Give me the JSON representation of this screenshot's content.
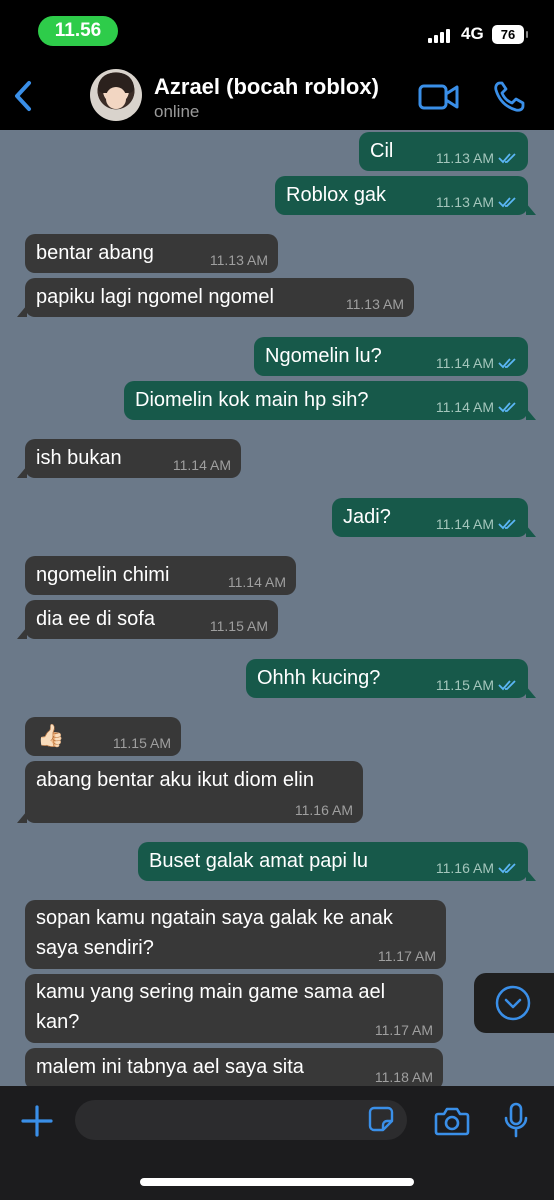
{
  "status_bar": {
    "time": "11.56",
    "network": "4G",
    "battery": "76"
  },
  "header": {
    "contact_name": "Azrael (bocah roblox)",
    "contact_status": "online"
  },
  "messages": [
    {
      "dir": "out",
      "text": "Cil",
      "time": "11.13 AM"
    },
    {
      "dir": "out",
      "text": "Roblox gak",
      "time": "11.13 AM"
    },
    {
      "dir": "in",
      "text": "bentar abang",
      "time": "11.13 AM"
    },
    {
      "dir": "in",
      "text": "papiku lagi ngomel ngomel",
      "time": "11.13 AM"
    },
    {
      "dir": "out",
      "text": "Ngomelin lu?",
      "time": "11.14 AM"
    },
    {
      "dir": "out",
      "text": "Diomelin kok main hp sih?",
      "time": "11.14 AM"
    },
    {
      "dir": "in",
      "text": "ish bukan",
      "time": "11.14 AM"
    },
    {
      "dir": "out",
      "text": "Jadi?",
      "time": "11.14 AM"
    },
    {
      "dir": "in",
      "text": "ngomelin chimi",
      "time": "11.14 AM"
    },
    {
      "dir": "in",
      "text": "dia ee di sofa",
      "time": "11.15 AM"
    },
    {
      "dir": "out",
      "text": "Ohhh kucing?",
      "time": "11.15 AM"
    },
    {
      "dir": "in",
      "text": "👍🏻",
      "time": "11.15 AM"
    },
    {
      "dir": "in",
      "text": "abang bentar aku ikut diom elin",
      "time": "11.16 AM"
    },
    {
      "dir": "out",
      "text": "Buset galak amat papi lu",
      "time": "11.16 AM"
    },
    {
      "dir": "in",
      "text": "sopan kamu ngatain saya galak ke anak saya sendiri?",
      "time": "11.17 AM"
    },
    {
      "dir": "in",
      "text": "kamu yang sering main game sama ael kan?",
      "time": "11.17 AM"
    },
    {
      "dir": "in",
      "text": "malem ini tabnya ael saya sita",
      "time": "11.18 AM"
    }
  ],
  "icons": {
    "back": "chevron-left-icon",
    "video": "video-camera-icon",
    "call": "phone-icon",
    "scroll_down": "chevron-down-circle-icon",
    "plus": "plus-icon",
    "sticker": "sticker-icon",
    "camera": "camera-icon",
    "mic": "microphone-icon"
  },
  "colors": {
    "accent": "#3a8fe8",
    "incoming_bubble": "#383838",
    "outgoing_bubble": "#17594a",
    "chat_background": "#6b7989",
    "time_pill": "#2ecc4a",
    "read_ticks": "#5bb6f5"
  }
}
